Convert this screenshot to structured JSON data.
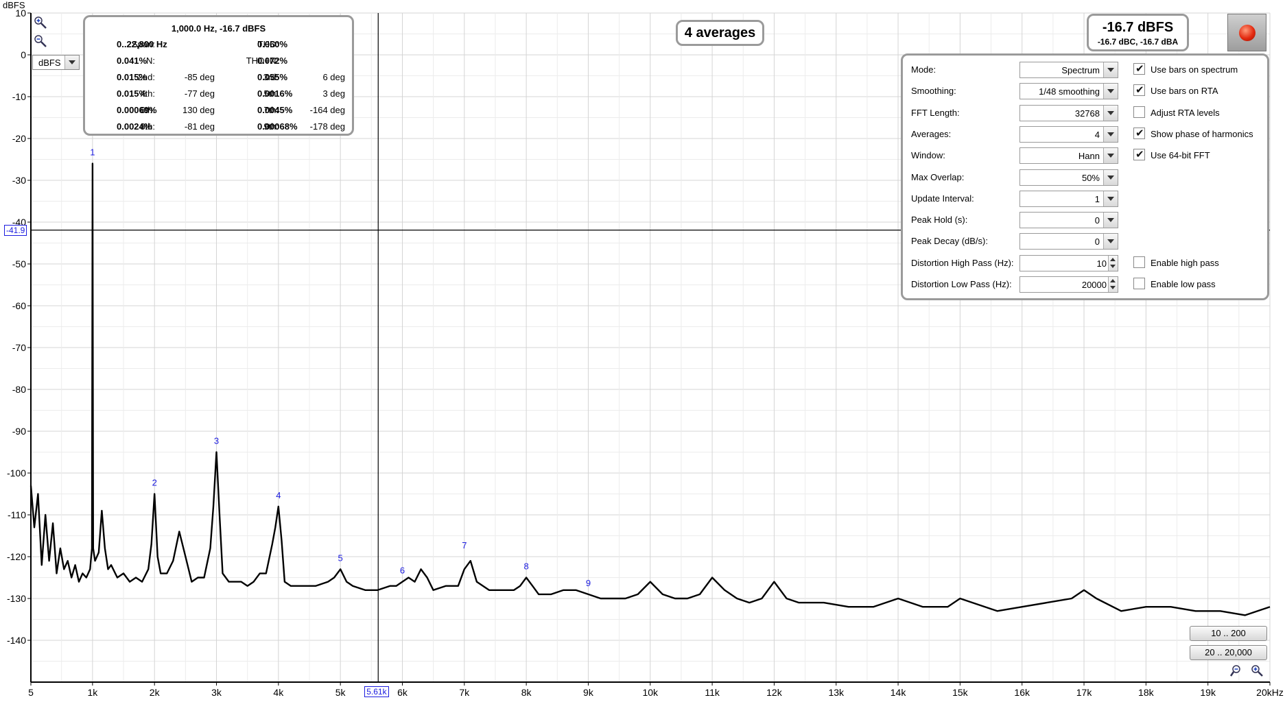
{
  "plot": {
    "unit_label": "dBFS",
    "units_select": "dBFS",
    "y_ticks": [
      "10",
      "0",
      "-10",
      "-20",
      "-30",
      "-40",
      "-50",
      "-60",
      "-70",
      "-80",
      "-90",
      "-100",
      "-110",
      "-120",
      "-130",
      "-140"
    ],
    "x_ticks": [
      "5",
      "1k",
      "2k",
      "3k",
      "4k",
      "5k",
      "6k",
      "7k",
      "8k",
      "9k",
      "10k",
      "11k",
      "12k",
      "13k",
      "14k",
      "15k",
      "16k",
      "17k",
      "18k",
      "19k",
      "20kHz"
    ],
    "cursor_y_label": "-41.9",
    "cursor_x_label": "5.61k",
    "cursor_freq_hz": 5610,
    "cursor_level_dbfs": -41.9,
    "colors": {
      "trace": "#000000",
      "grid": "#d4d4d4",
      "cursor": "#000000",
      "marker": "#1a1adf",
      "axis": "#000000"
    }
  },
  "chart_data": {
    "type": "line",
    "xlabel": "",
    "ylabel": "dBFS",
    "xlim": [
      5,
      20000
    ],
    "ylim": [
      -150,
      10
    ],
    "harmonic_markers": [
      {
        "label": "1",
        "x": 1000,
        "y": -26
      },
      {
        "label": "2",
        "x": 2000,
        "y": -105
      },
      {
        "label": "3",
        "x": 3000,
        "y": -95
      },
      {
        "label": "4",
        "x": 4000,
        "y": -108
      },
      {
        "label": "5",
        "x": 5000,
        "y": -123
      },
      {
        "label": "6",
        "x": 6000,
        "y": -126
      },
      {
        "label": "7",
        "x": 7000,
        "y": -120
      },
      {
        "label": "8",
        "x": 8000,
        "y": -125
      },
      {
        "label": "9",
        "x": 9000,
        "y": -129
      }
    ],
    "series": [
      {
        "x": [
          5,
          60,
          120,
          180,
          240,
          300,
          360,
          420,
          480,
          540,
          600,
          660,
          720,
          780,
          840,
          900,
          960,
          990,
          1000,
          1010,
          1040,
          1100,
          1150,
          1200,
          1250,
          1300,
          1400,
          1500,
          1600,
          1700,
          1800,
          1900,
          1950,
          2000,
          2050,
          2100,
          2200,
          2300,
          2400,
          2500,
          2600,
          2700,
          2800,
          2900,
          2950,
          3000,
          3050,
          3100,
          3200,
          3300,
          3400,
          3500,
          3600,
          3700,
          3800,
          3900,
          3950,
          4000,
          4050,
          4100,
          4200,
          4400,
          4600,
          4800,
          4900,
          5000,
          5100,
          5200,
          5400,
          5600,
          5800,
          5900,
          6000,
          6100,
          6200,
          6300,
          6400,
          6500,
          6700,
          6900,
          7000,
          7100,
          7200,
          7400,
          7600,
          7800,
          7900,
          8000,
          8100,
          8200,
          8400,
          8600,
          8800,
          9000,
          9200,
          9400,
          9600,
          9800,
          10000,
          10200,
          10400,
          10600,
          10800,
          11000,
          11200,
          11400,
          11600,
          11800,
          12000,
          12200,
          12400,
          12800,
          13200,
          13600,
          14000,
          14400,
          14800,
          15000,
          15200,
          15600,
          16000,
          16400,
          16800,
          17000,
          17200,
          17600,
          18000,
          18400,
          18800,
          19200,
          19600,
          20000
        ],
        "y": [
          -103,
          -113,
          -105,
          -122,
          -110,
          -121,
          -112,
          -124,
          -118,
          -123,
          -121,
          -125,
          -122,
          -126,
          -124,
          -125,
          -123,
          -118,
          -26,
          -118,
          -121,
          -119,
          -109,
          -118,
          -123,
          -122,
          -125,
          -124,
          -126,
          -125,
          -126,
          -123,
          -117,
          -105,
          -120,
          -124,
          -124,
          -121,
          -114,
          -120,
          -126,
          -125,
          -125,
          -118,
          -108,
          -95,
          -110,
          -124,
          -126,
          -126,
          -126,
          -127,
          -126,
          -124,
          -124,
          -117,
          -113,
          -108,
          -116,
          -126,
          -127,
          -127,
          -127,
          -126,
          -125,
          -123,
          -126,
          -127,
          -128,
          -128,
          -127,
          -127,
          -126,
          -125,
          -126,
          -123,
          -125,
          -128,
          -127,
          -127,
          -123,
          -121,
          -126,
          -128,
          -128,
          -128,
          -127,
          -125,
          -127,
          -129,
          -129,
          -128,
          -128,
          -129,
          -130,
          -130,
          -130,
          -129,
          -126,
          -129,
          -130,
          -130,
          -129,
          -125,
          -128,
          -130,
          -131,
          -130,
          -126,
          -130,
          -131,
          -131,
          -132,
          -132,
          -130,
          -132,
          -132,
          -130,
          -131,
          -133,
          -132,
          -131,
          -130,
          -128,
          -130,
          -133,
          -132,
          -132,
          -133,
          -133,
          -134,
          -132
        ]
      }
    ]
  },
  "harmonics": {
    "header": "1,000.0 Hz, -16.7 dBFS",
    "span_label": "Span:",
    "span_value": "0..22,800 Hz",
    "thd_label": "THD:",
    "thd_value": "0.060%",
    "n_label": "N:",
    "n_value": "0.041%",
    "thdn_label": "THD+N:",
    "thdn_value": "0.072%",
    "rows": [
      {
        "l1": "2nd:",
        "v1": "0.015%",
        "p1": "-85 deg",
        "l2": "3rd:",
        "v2": "0.055%",
        "p2": "6 deg"
      },
      {
        "l1": "4th:",
        "v1": "0.015%",
        "p1": "-77 deg",
        "l2": "5th:",
        "v2": "0.0016%",
        "p2": "3 deg"
      },
      {
        "l1": "6th:",
        "v1": "0.00069%",
        "p1": "130 deg",
        "l2": "7th:",
        "v2": "0.0045%",
        "p2": "-164 deg"
      },
      {
        "l1": "8th:",
        "v1": "0.0024%",
        "p1": "-81 deg",
        "l2": "9th:",
        "v2": "0.00068%",
        "p2": "-178 deg"
      }
    ]
  },
  "averages_label": "4 averages",
  "level": {
    "main": "-16.7 dBFS",
    "sub": "-16.7 dBC, -16.7 dBA"
  },
  "controls": {
    "rows": [
      {
        "label": "Mode:",
        "value": "Spectrum",
        "kind": "select",
        "check_label": "Use bars on spectrum",
        "checked": true
      },
      {
        "label": "Smoothing:",
        "value": "1/48 smoothing",
        "kind": "select",
        "check_label": "Use bars on RTA",
        "checked": true
      },
      {
        "label": "FFT Length:",
        "value": "32768",
        "kind": "select",
        "check_label": "Adjust RTA levels",
        "checked": false
      },
      {
        "label": "Averages:",
        "value": "4",
        "kind": "select",
        "check_label": "Show phase of harmonics",
        "checked": true
      },
      {
        "label": "Window:",
        "value": "Hann",
        "kind": "select",
        "check_label": "Use 64-bit FFT",
        "checked": true
      },
      {
        "label": "Max Overlap:",
        "value": "50%",
        "kind": "select",
        "check_label": "",
        "checked": false
      },
      {
        "label": "Update Interval:",
        "value": "1",
        "kind": "select",
        "check_label": "",
        "checked": false
      },
      {
        "label": "Peak Hold (s):",
        "value": "0",
        "kind": "select",
        "check_label": "",
        "checked": false
      },
      {
        "label": "Peak Decay (dB/s):",
        "value": "0",
        "kind": "select",
        "check_label": "",
        "checked": false
      },
      {
        "label": "Distortion High Pass (Hz):",
        "value": "10",
        "kind": "spin",
        "check_label": "Enable high pass",
        "checked": false
      },
      {
        "label": "Distortion Low Pass (Hz):",
        "value": "20000",
        "kind": "spin",
        "check_label": "Enable low pass",
        "checked": false
      }
    ]
  },
  "range_buttons": {
    "low": "10 .. 200",
    "high": "20 .. 20,000"
  }
}
